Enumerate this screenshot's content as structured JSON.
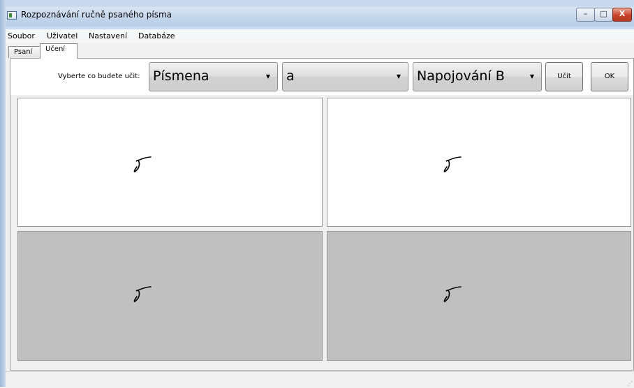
{
  "window": {
    "title": "Rozpoznávání ručně psaného písma"
  },
  "window_controls": {
    "minimize": "–",
    "maximize": "□",
    "close": "X"
  },
  "menu": {
    "items": [
      "Soubor",
      "Uživatel",
      "Nastavení",
      "Databáze"
    ]
  },
  "tabs": {
    "items": [
      {
        "label": "Psaní",
        "active": false
      },
      {
        "label": "Učení",
        "active": true
      }
    ]
  },
  "learn": {
    "prompt": "Vyberte co budete učit:",
    "combo_type": "Písmena",
    "combo_char": "a",
    "combo_connect": "Napojování B",
    "learn_button": "Učit",
    "ok_button": "OK"
  },
  "canvases": [
    {
      "bg": "white",
      "glyph": "handwritten-sigma"
    },
    {
      "bg": "white",
      "glyph": "handwritten-sigma"
    },
    {
      "bg": "gray",
      "glyph": "handwritten-sigma"
    },
    {
      "bg": "gray",
      "glyph": "handwritten-sigma"
    }
  ],
  "colors": {
    "canvas_gray": "#c0c0c0",
    "close_red": "#c9432a"
  }
}
